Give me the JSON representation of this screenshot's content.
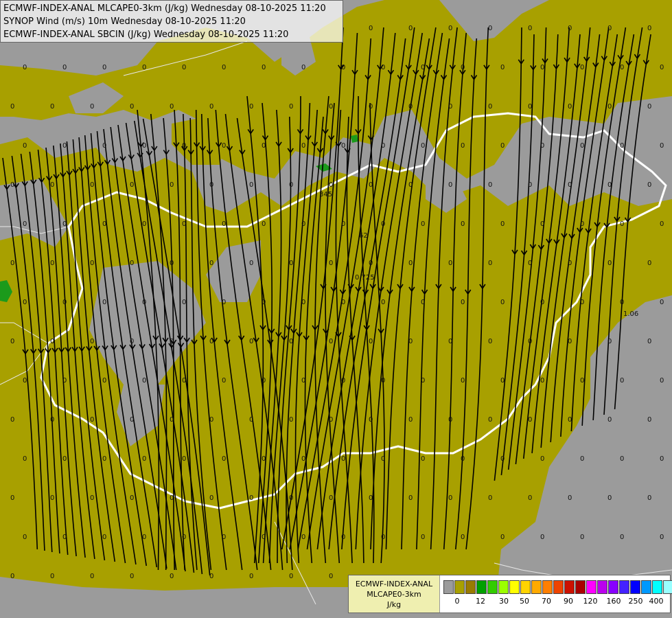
{
  "header": {
    "lines": [
      "ECMWF-INDEX-ANAL MLCAPE0-3km (J/kg) Wednesday 08-10-2025 11:20",
      "SYNOP Wind (m/s) 10m Wednesday 08-10-2025 11:20",
      "ECMWF-INDEX-ANAL SBCIN (J/kg) Wednesday 08-10-2025 11:20"
    ]
  },
  "legend": {
    "title_lines": [
      "ECMWF-INDEX-ANAL",
      "MLCAPE0-3km",
      "J/kg"
    ],
    "colors": [
      "#9b9b9b",
      "#a8a000",
      "#9a7b00",
      "#00a000",
      "#33cc00",
      "#9cff00",
      "#ffff00",
      "#ffd400",
      "#ffaa00",
      "#ff7f00",
      "#ee4400",
      "#cc1100",
      "#aa0000",
      "#ff00ff",
      "#bb00ee",
      "#8800ff",
      "#4422ff",
      "#0000ff",
      "#0099ff",
      "#00ffff",
      "#99ffff",
      "#ffffff"
    ],
    "ticks": [
      "0",
      "12",
      "30",
      "50",
      "70",
      "90",
      "120",
      "160",
      "250",
      "400"
    ]
  },
  "colors": {
    "background": "#9b9b9b",
    "cape_low": "#a8a000",
    "cape_green": "#1b9a1b",
    "borders": "#ffffff",
    "streamlines": "#000000"
  },
  "map_values": {
    "zero_label": "0",
    "special": [
      "345",
      "62",
      "0.725",
      "1.06"
    ]
  }
}
